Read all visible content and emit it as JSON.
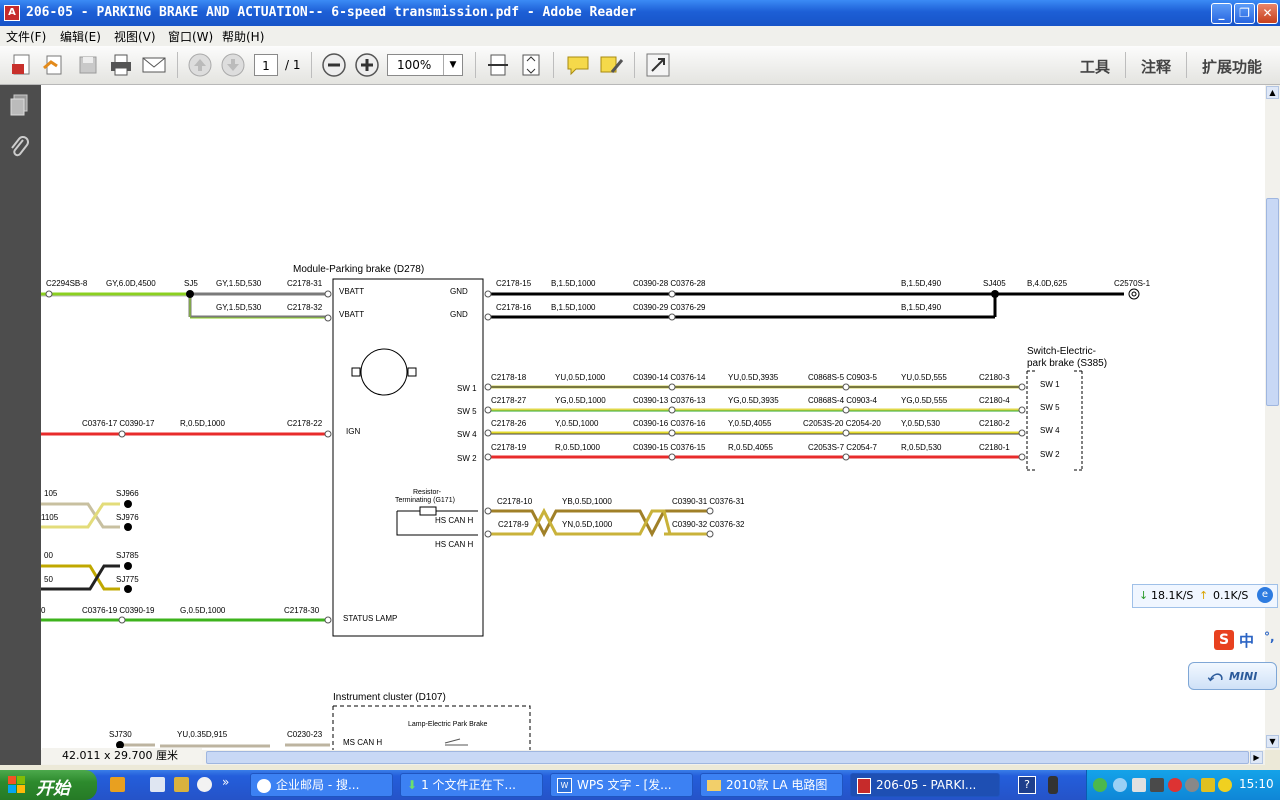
{
  "window": {
    "title": "206-05 - PARKING BRAKE AND ACTUATION-- 6-speed transmission.pdf - Adobe Reader",
    "app_icon": "pdf-icon"
  },
  "menu": [
    "文件(F)",
    "编辑(E)",
    "视图(V)",
    "窗口(W)",
    "帮助(H)"
  ],
  "toolbar": {
    "page_current": "1",
    "page_total": "/ 1",
    "zoom": "100%",
    "right": [
      "工具",
      "注释",
      "扩展功能"
    ]
  },
  "status": {
    "page_size": "42.011 x 29.700 厘米"
  },
  "diagram": {
    "module_title": "Module-Parking brake (D278)",
    "module_pins": [
      "VBATT",
      "VBATT",
      "GND",
      "GND",
      "SW 1",
      "SW 5",
      "SW 4",
      "SW 2",
      "IGN",
      "HS CAN H",
      "HS CAN H",
      "STATUS LAMP"
    ],
    "switch_title": "Switch-Electric-",
    "switch_title2": "park brake (S385)",
    "switch_pins": [
      "SW 1",
      "SW 5",
      "SW 4",
      "SW 2"
    ],
    "resistor": "Resistor-",
    "resistor2": "Terminating (G171)",
    "cluster_title": "Instrument cluster (D107)",
    "cluster_lamp": "Lamp-Electric Park Brake",
    "cluster_pin": "MS CAN H",
    "labels": {
      "l1": "C2294SB-8",
      "l2": "GY,6.0D,4500",
      "l3": "SJ5",
      "l4": "GY,1.5D,530",
      "l5": "C2178-31",
      "l6": "GY,1.5D,530",
      "l7": "C2178-32",
      "l8": "C2178-15",
      "l9": "B,1.5D,1000",
      "l10": "C0390-28 C0376-28",
      "l11": "B,1.5D,490",
      "l12": "SJ405",
      "l13": "B,4.0D,625",
      "l14": "C2570S-1",
      "l15": "C2178-16",
      "l16": "B,1.5D,1000",
      "l17": "C0390-29 C0376-29",
      "l18": "B,1.5D,490",
      "r1a": "C2178-18",
      "r1b": "YU,0.5D,1000",
      "r1c": "C0390-14 C0376-14",
      "r1d": "YU,0.5D,3935",
      "r1e": "C0868S-5 C0903-5",
      "r1f": "YU,0.5D,555",
      "r1g": "C2180-3",
      "r2a": "C2178-27",
      "r2b": "YG,0.5D,1000",
      "r2c": "C0390-13 C0376-13",
      "r2d": "YG,0.5D,3935",
      "r2e": "C0868S-4 C0903-4",
      "r2f": "YG,0.5D,555",
      "r2g": "C2180-4",
      "r3a": "C2178-26",
      "r3b": "Y,0.5D,1000",
      "r3c": "C0390-16 C0376-16",
      "r3d": "Y,0.5D,4055",
      "r3e": "C2053S-20 C2054-20",
      "r3f": "Y,0.5D,530",
      "r3g": "C2180-2",
      "r4a": "C2178-19",
      "r4b": "R,0.5D,1000",
      "r4c": "C0390-15 C0376-15",
      "r4d": "R,0.5D,4055",
      "r4e": "C2053S-7 C2054-7",
      "r4f": "R,0.5D,530",
      "r4g": "C2180-1",
      "ign1": "C0376-17 C0390-17",
      "ign2": "R,0.5D,1000",
      "ign3": "C2178-22",
      "can1": "C2178-10",
      "can2": "YB,0.5D,1000",
      "can3": "C0390-31 C0376-31",
      "can4": "C2178-9",
      "can5": "YN,0.5D,1000",
      "can6": "C0390-32 C0376-32",
      "sj1": "105",
      "sj2": "SJ966",
      "sj3": "1105",
      "sj4": "SJ976",
      "sj5": "00",
      "sj6": "SJ785",
      "sj7": "50",
      "sj8": "SJ775",
      "st1": "0",
      "st2": "C0376-19 C0390-19",
      "st3": "G,0.5D,1000",
      "st4": "C2178-30",
      "b1": "SJ730",
      "b2": "YU,0.35D,915",
      "b3": "C0230-23"
    }
  },
  "net": {
    "down": "18.1K/S",
    "up": "0.1K/S"
  },
  "ime": {
    "label": "中"
  },
  "mini": {
    "label": "MINI"
  },
  "taskbar": {
    "start": "开始",
    "tasks": [
      "企业邮局 - 搜...",
      "1 个文件正在下...",
      "WPS 文字 - [发...",
      "2010款 LA 电路图",
      "206-05 - PARKI..."
    ],
    "clock": "15:10"
  }
}
